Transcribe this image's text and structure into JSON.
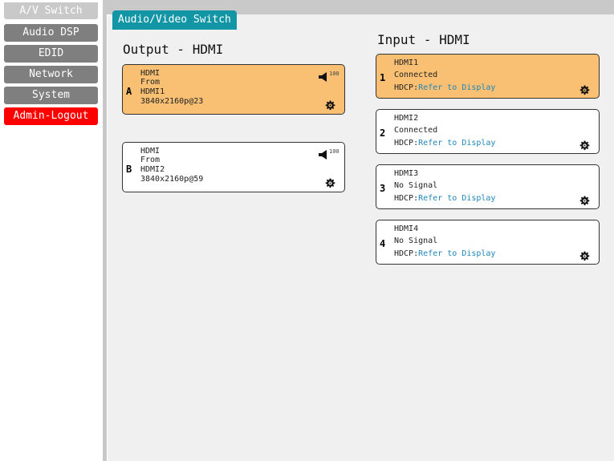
{
  "sidebar": {
    "items": [
      {
        "label": "A/V Switch"
      },
      {
        "label": "Audio DSP"
      },
      {
        "label": "EDID"
      },
      {
        "label": "Network"
      },
      {
        "label": "System"
      },
      {
        "label": "Admin-Logout"
      }
    ]
  },
  "tab": {
    "label": "Audio/Video Switch"
  },
  "outputs": {
    "title": "Output - HDMI",
    "cards": [
      {
        "letter": "A",
        "type": "HDMI",
        "from_label": "From",
        "source": "HDMI1",
        "resolution": "3840x2160p@23",
        "volume": "100",
        "active": true
      },
      {
        "letter": "B",
        "type": "HDMI",
        "from_label": "From",
        "source": "HDMI2",
        "resolution": "3840x2160p@59",
        "volume": "100",
        "active": false
      }
    ]
  },
  "inputs": {
    "title": "Input - HDMI",
    "cards": [
      {
        "number": "1",
        "name": "HDMI1",
        "status": "Connected",
        "hdcp_label": "HDCP:",
        "hdcp_value": "Refer to Display",
        "active": true
      },
      {
        "number": "2",
        "name": "HDMI2",
        "status": "Connected",
        "hdcp_label": "HDCP:",
        "hdcp_value": "Refer to Display",
        "active": false
      },
      {
        "number": "3",
        "name": "HDMI3",
        "status": "No Signal",
        "hdcp_label": "HDCP:",
        "hdcp_value": "Refer to Display",
        "active": false
      },
      {
        "number": "4",
        "name": "HDMI4",
        "status": "No Signal",
        "hdcp_label": "HDCP:",
        "hdcp_value": "Refer to Display",
        "active": false
      }
    ]
  },
  "colors": {
    "active_card": "#f9c074",
    "tab": "#1296a6",
    "logout": "#ff0000",
    "nav": "#7f7f7f",
    "hdcp_link": "#1f86b7"
  },
  "icons": {
    "speaker": "speaker-icon",
    "settings": "gear-icon"
  }
}
